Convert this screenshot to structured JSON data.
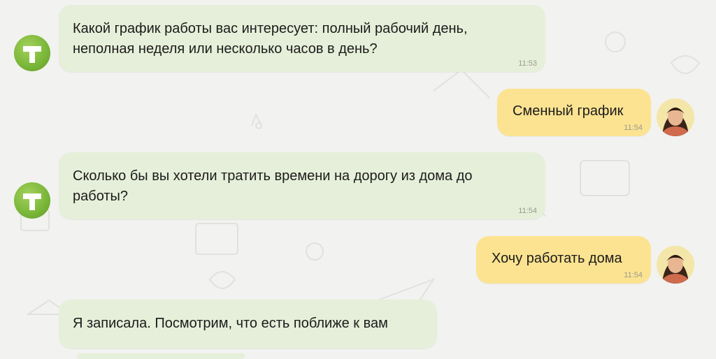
{
  "chat": {
    "messages": [
      {
        "author": "bot",
        "text": "Какой график работы вас интересует: полный рабочий день,\nнеполная неделя или несколько часов в день?",
        "time": "11:53"
      },
      {
        "author": "user",
        "text": "Сменный график",
        "time": "11:54"
      },
      {
        "author": "bot",
        "text": "Сколько бы вы хотели тратить времени на дорогу из дома до\nработы?",
        "time": "11:54"
      },
      {
        "author": "user",
        "text": "Хочу работать дома",
        "time": "11:54"
      },
      {
        "author": "bot",
        "text": "Я записала. Посмотрим, что есть поближе к вам",
        "time": ""
      }
    ]
  },
  "colors": {
    "bot_bubble": "#e6efd9",
    "user_bubble": "#fce391",
    "bot_avatar": "#7cb83a",
    "background": "#f2f2f0"
  },
  "icons": {
    "bot_avatar": "t-logo-icon",
    "user_avatar": "user-photo"
  }
}
